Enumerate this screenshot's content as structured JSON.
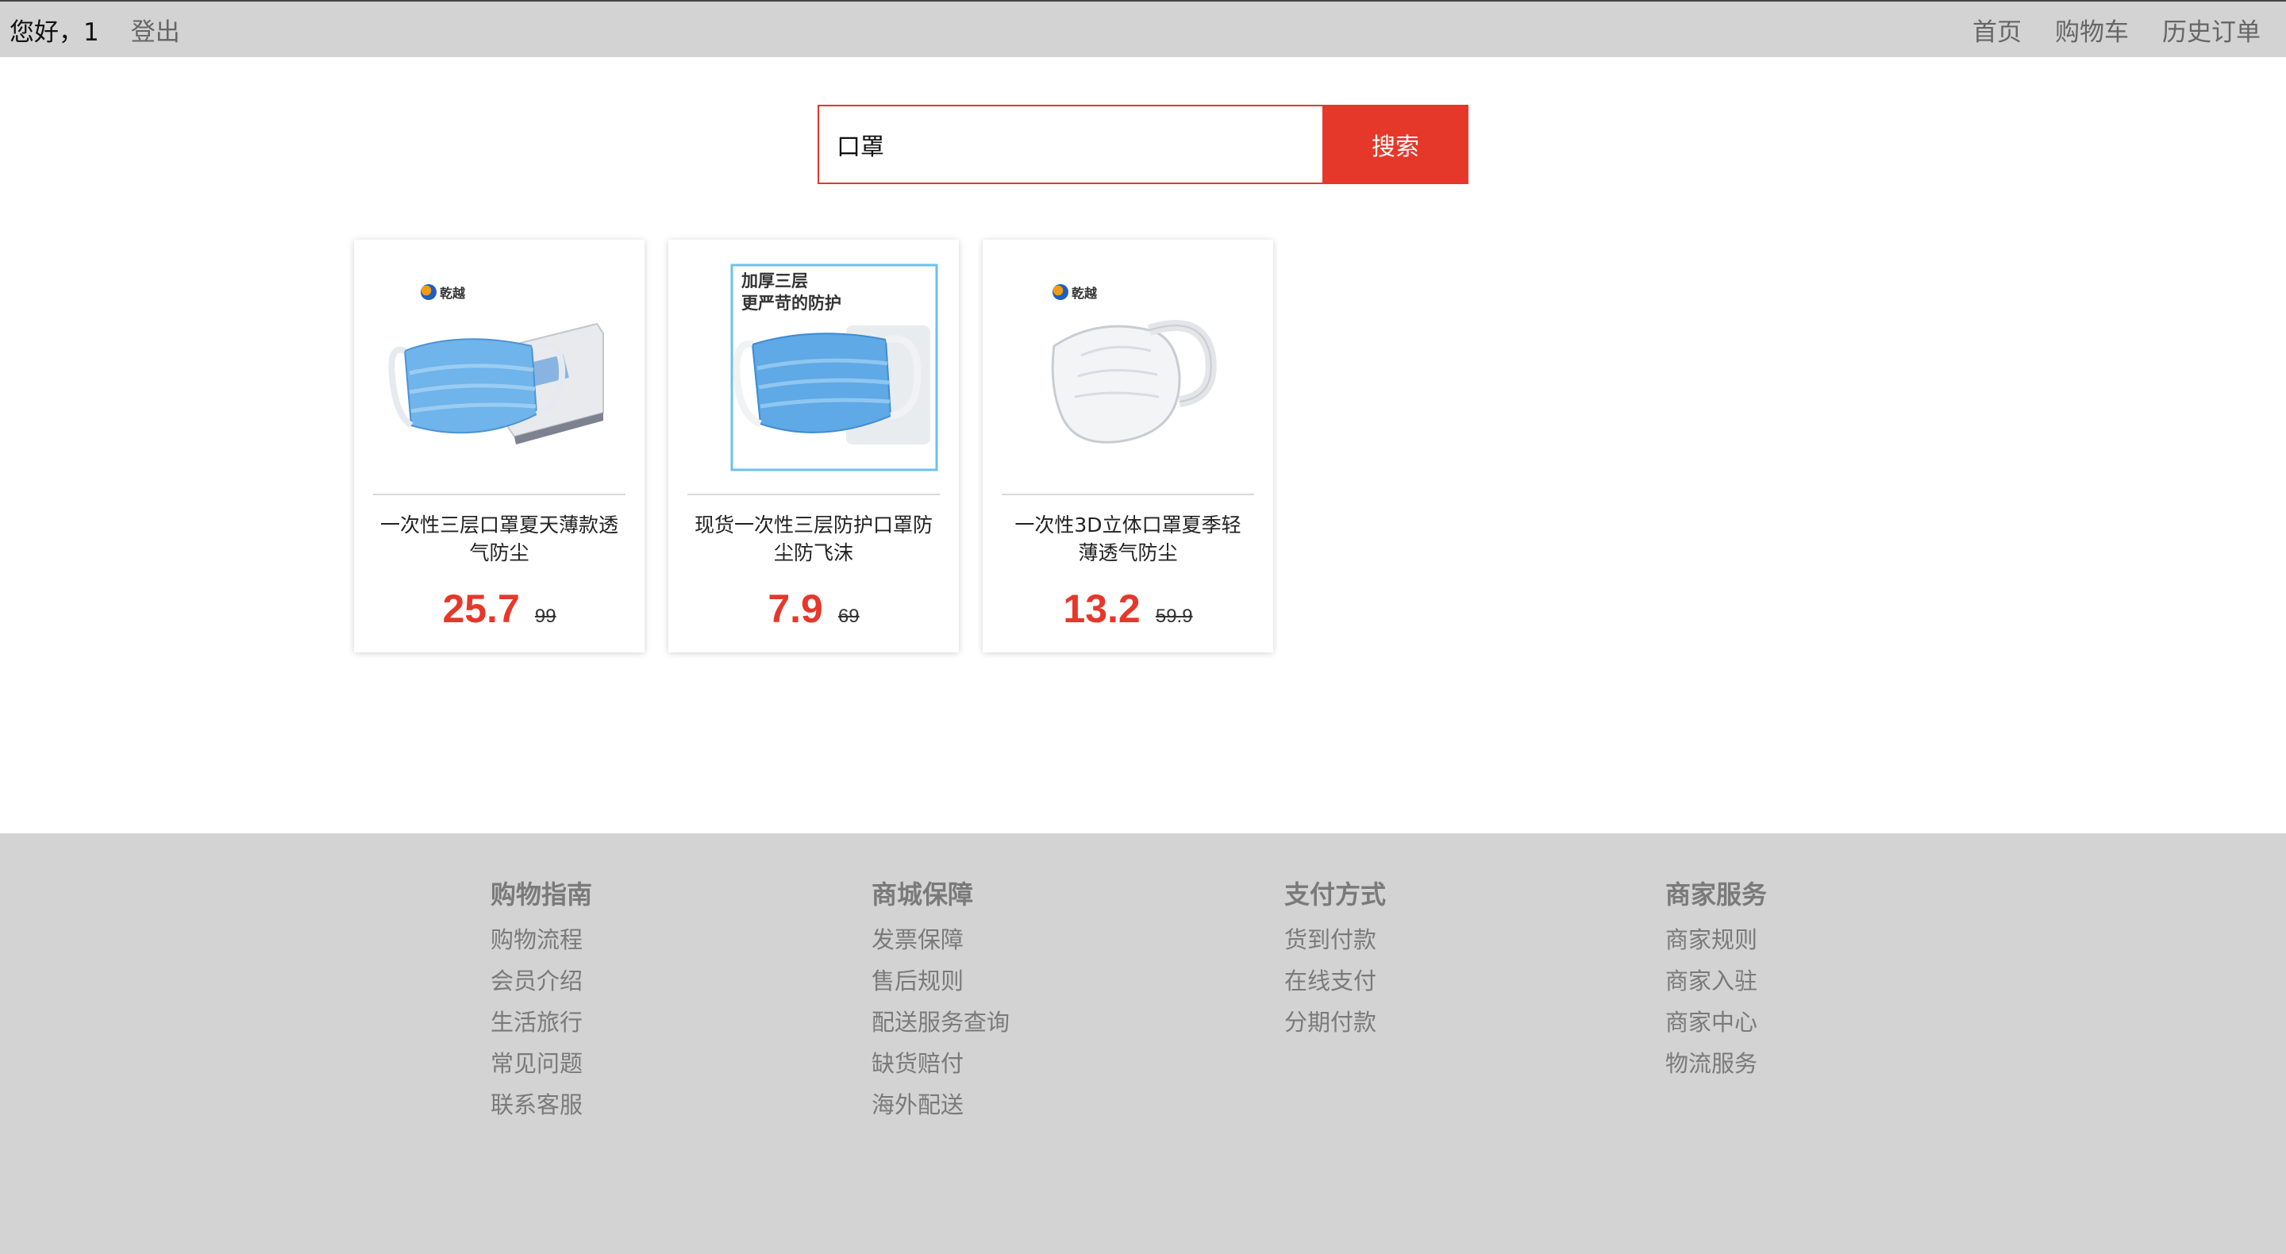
{
  "header": {
    "greeting": "您好，1",
    "logout": "登出",
    "nav": [
      "首页",
      "购物车",
      "历史订单"
    ]
  },
  "search": {
    "value": "口罩",
    "button": "搜索"
  },
  "products": [
    {
      "name": "一次性三层口罩夏天薄款透气防尘",
      "price": "25.7",
      "original_price": "99",
      "image": "blue-mask-with-box",
      "brand": "乾越"
    },
    {
      "name": "现货一次性三层防护口罩防尘防飞沫",
      "price": "7.9",
      "original_price": "69",
      "image": "blue-mask-framed",
      "promo_title": "加厚三层",
      "promo_subtitle": "更严苛的防护"
    },
    {
      "name": "一次性3D立体口罩夏季轻薄透气防尘",
      "price": "13.2",
      "original_price": "59.9",
      "image": "white-3d-mask",
      "brand": "乾越"
    }
  ],
  "footer": {
    "columns": [
      {
        "title": "购物指南",
        "links": [
          "购物流程",
          "会员介绍",
          "生活旅行",
          "常见问题",
          "联系客服"
        ]
      },
      {
        "title": "商城保障",
        "links": [
          "发票保障",
          "售后规则",
          "配送服务查询",
          "缺货赔付",
          "海外配送"
        ]
      },
      {
        "title": "支付方式",
        "links": [
          "货到付款",
          "在线支付",
          "分期付款"
        ]
      },
      {
        "title": "商家服务",
        "links": [
          "商家规则",
          "商家入驻",
          "商家中心",
          "物流服务"
        ]
      }
    ]
  },
  "colors": {
    "accent": "#e5382b",
    "topbar_bg": "#d3d3d3",
    "footer_bg": "#d3d3d3",
    "muted_text": "#7a7a7a"
  }
}
